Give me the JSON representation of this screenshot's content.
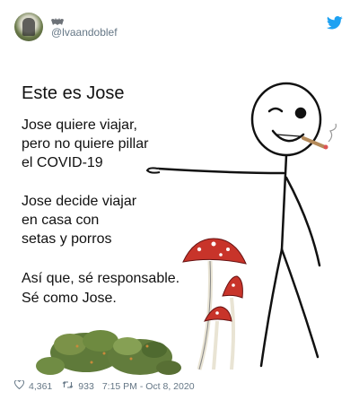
{
  "tweet": {
    "handle": "@lvaandoblef",
    "twitter_icon": "twitter-bird-icon",
    "badge_icon": "bat-icon",
    "likes_count": "4,361",
    "retweets_count": "933",
    "timestamp": "7:15 PM - Oct 8, 2020"
  },
  "meme": {
    "title": "Este es Jose",
    "line1": "Jose quiere viajar,",
    "line2": "pero no quiere pillar",
    "line3": "el COVID-19",
    "line4": "Jose decide viajar",
    "line5": "en casa con",
    "line6": "setas y porros",
    "line7": "Así que, sé responsable.",
    "line8": "Sé como Jose."
  },
  "colors": {
    "twitter_blue": "#1da1f2",
    "muted_text": "#657786",
    "mushroom_red": "#c8342a"
  }
}
